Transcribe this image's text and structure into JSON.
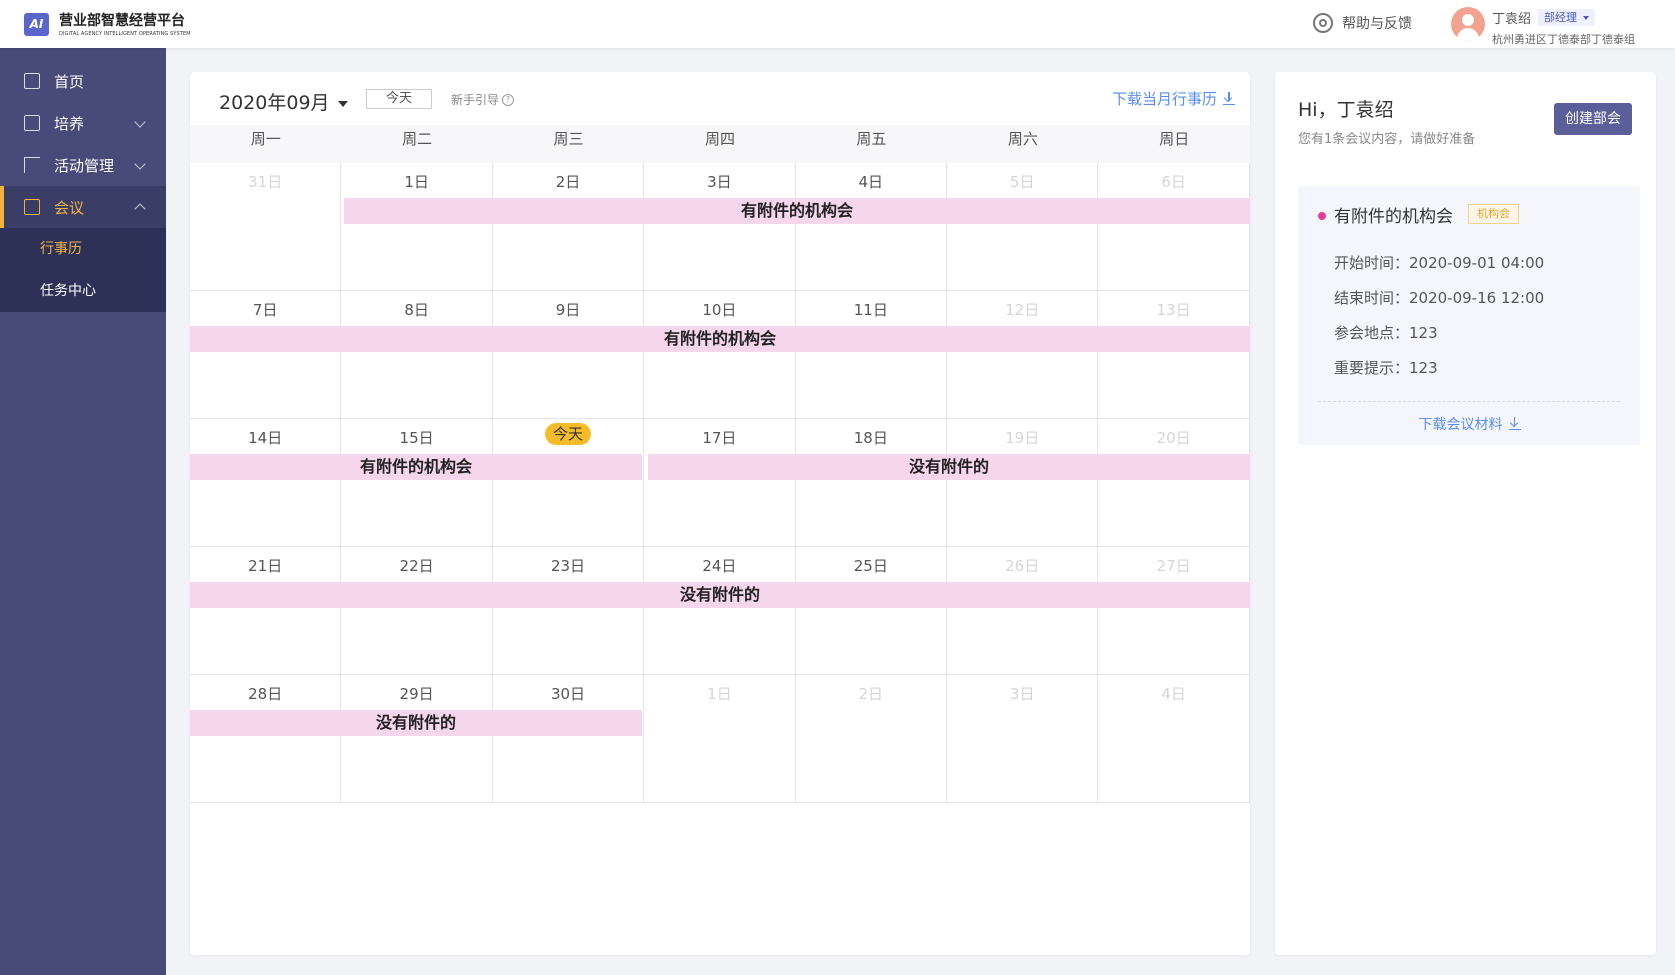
{
  "header": {
    "logo_text": "AI",
    "brand_title": "营业部智慧经营平台",
    "brand_subtitle": "DIGITAL AGENCY INTELLIGENT OPERATING SYSTEM",
    "help_label": "帮助与反馈",
    "user_name": "丁袁绍",
    "role": "部经理",
    "org": "杭州勇进区丁德泰部丁德泰组"
  },
  "sidebar": {
    "items": [
      {
        "label": "首页",
        "icon": "home-icon"
      },
      {
        "label": "培养",
        "icon": "book-icon"
      },
      {
        "label": "活动管理",
        "icon": "flag-icon"
      },
      {
        "label": "会议",
        "icon": "monitor-icon"
      }
    ],
    "submenu": [
      {
        "label": "行事历"
      },
      {
        "label": "任务中心"
      }
    ]
  },
  "calendar": {
    "month_label": "2020年09月",
    "today_button": "今天",
    "guide": "新手引导",
    "guide_icon": "?",
    "download_month": "下载当月行事历",
    "weekdays": [
      "周一",
      "周二",
      "周三",
      "周四",
      "周五",
      "周六",
      "周日"
    ],
    "weeks": [
      [
        "31日",
        "1日",
        "2日",
        "3日",
        "4日",
        "5日",
        "6日"
      ],
      [
        "7日",
        "8日",
        "9日",
        "10日",
        "11日",
        "12日",
        "13日"
      ],
      [
        "14日",
        "15日",
        "今天",
        "17日",
        "18日",
        "19日",
        "20日"
      ],
      [
        "21日",
        "22日",
        "23日",
        "24日",
        "25日",
        "26日",
        "27日"
      ],
      [
        "28日",
        "29日",
        "30日",
        "1日",
        "2日",
        "3日",
        "4日"
      ]
    ],
    "events": [
      {
        "title": "有附件的机构会"
      },
      {
        "title": "有附件的机构会"
      },
      {
        "title": "有附件的机构会"
      },
      {
        "title": "没有附件的"
      },
      {
        "title": "没有附件的"
      },
      {
        "title": "没有附件的"
      }
    ],
    "event_color": "#f5d6ec",
    "today_color": "#f5bb28"
  },
  "panel": {
    "greeting": "Hi，丁袁绍",
    "tip": "您有1条会议内容，请做好准备",
    "create_button": "创建部会",
    "meeting": {
      "title": "有附件的机构会",
      "tag": "机构会",
      "start": "开始时间：2020-09-01 04:00",
      "end": "结束时间：2020-09-16 12:00",
      "location": "参会地点：123",
      "notice": "重要提示：123",
      "download": "下载会议材料"
    }
  },
  "colors": {
    "sidebar_bg": "#484b78",
    "active_accent": "#f2b33d",
    "link_blue": "#5b8ef0",
    "button_bg": "#5b5f99"
  }
}
